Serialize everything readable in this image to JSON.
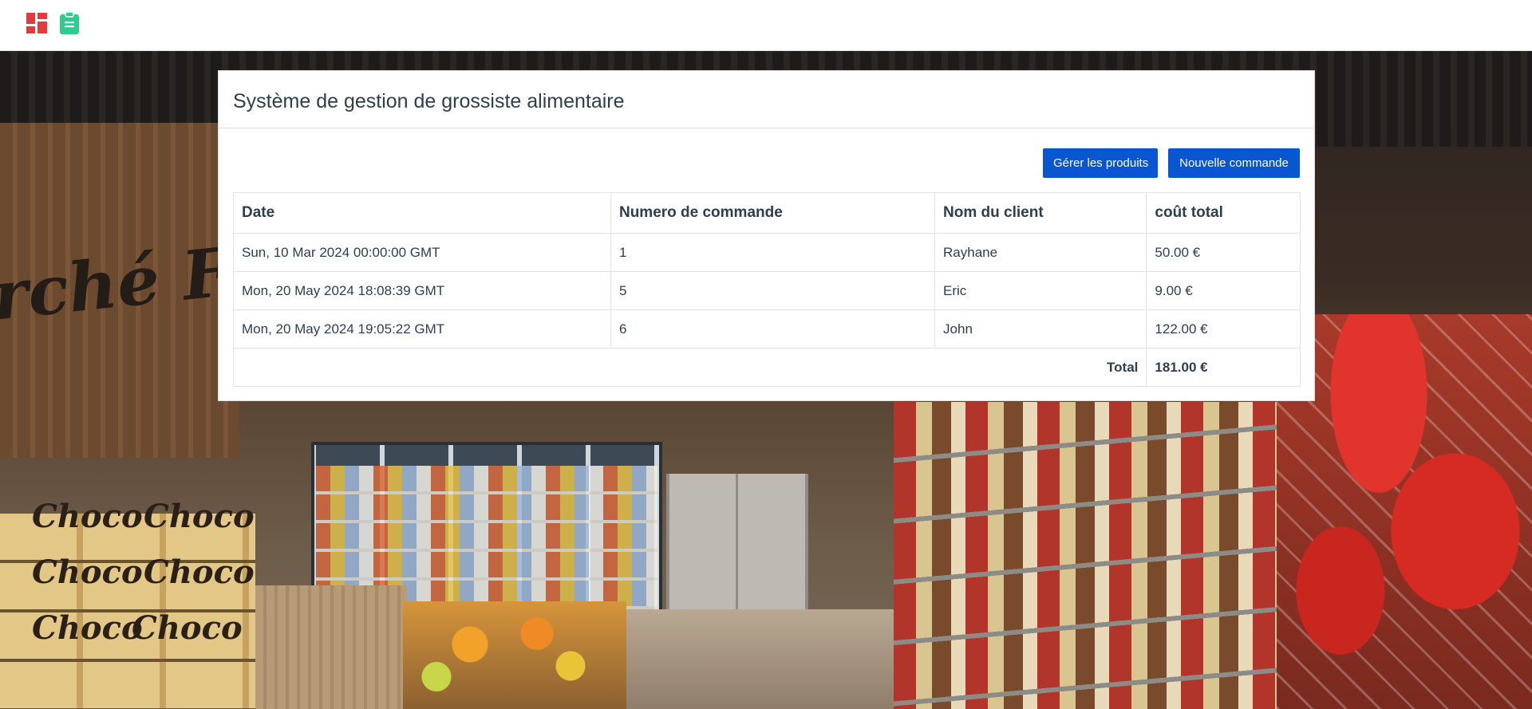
{
  "navbar": {
    "icons": [
      "dashboard-icon",
      "clipboard-icon"
    ],
    "colors": {
      "dashboard": "#e8383d",
      "clipboard": "#2ecc8f"
    }
  },
  "card": {
    "title": "Système de gestion de grossiste alimentaire",
    "buttons": {
      "manage_products": "Gérer les produits",
      "new_order": "Nouvelle commande"
    },
    "accent_color": "#0a56d0"
  },
  "table": {
    "headers": [
      "Date",
      "Numero de commande",
      "Nom du client",
      "coût total"
    ],
    "rows": [
      {
        "date": "Sun, 10 Mar 2024 00:00:00 GMT",
        "number": "1",
        "client": "Rayhane",
        "cost": "50.00 €"
      },
      {
        "date": "Mon, 20 May 2024 18:08:39 GMT",
        "number": "5",
        "client": "Eric",
        "cost": "9.00 €"
      },
      {
        "date": "Mon, 20 May 2024 19:05:22 GMT",
        "number": "6",
        "client": "John",
        "cost": "122.00 €"
      }
    ],
    "total_label": "Total",
    "total_value": "181.00 €"
  },
  "background": {
    "sign_text": "rché Fr",
    "choco_text": "Choco"
  }
}
